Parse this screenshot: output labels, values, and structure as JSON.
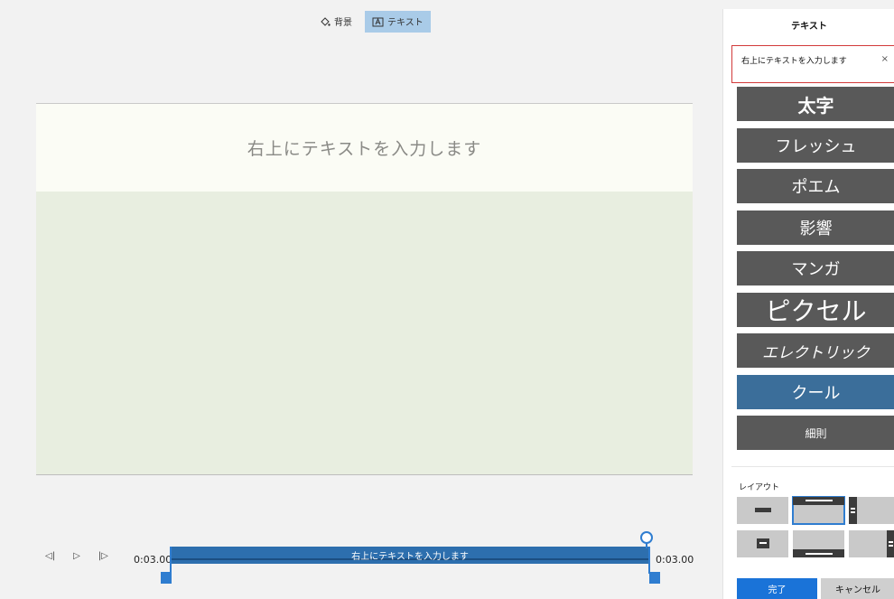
{
  "toolbar": {
    "background_label": "背景",
    "text_label": "テキスト",
    "background_icon": "paint-bucket-icon",
    "text_icon": "text-box-icon"
  },
  "preview": {
    "text": "右上にテキストを入力します"
  },
  "player": {
    "start_time": "0:03.00",
    "end_time": "0:03.00",
    "clip_label": "右上にテキストを入力します"
  },
  "panel": {
    "title": "テキスト",
    "input_value": "右上にテキストを入力します",
    "clear_icon": "×",
    "styles": [
      "太字",
      "フレッシュ",
      "ポエム",
      "影響",
      "マンガ",
      "ピクセル",
      "エレクトリック",
      "クール",
      "細則"
    ],
    "selected_style": "クール",
    "layout_label": "レイアウト",
    "ok_label": "完了",
    "cancel_label": "キャンセル"
  },
  "colors": {
    "accent": "#1a73d8",
    "selected_style": "#3b6e9a",
    "style_bg": "#595959",
    "highlight_border": "#d23a3a"
  }
}
